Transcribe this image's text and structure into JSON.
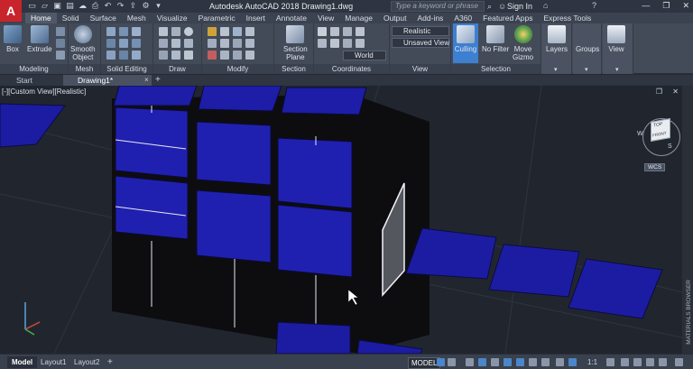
{
  "app": {
    "logo_letter": "A",
    "title": "Autodesk AutoCAD 2018   Drawing1.dwg",
    "search_placeholder": "Type a keyword or phrase",
    "sign_in": "Sign In",
    "window_buttons": [
      "—",
      "❐",
      "✕"
    ]
  },
  "ribbon_tabs": [
    "Home",
    "Solid",
    "Surface",
    "Mesh",
    "Visualize",
    "Parametric",
    "Insert",
    "Annotate",
    "View",
    "Manage",
    "Output",
    "Add-ins",
    "A360",
    "Featured Apps",
    "Express Tools"
  ],
  "active_tab": "Home",
  "ribbon": {
    "tools": {
      "box": "Box",
      "extrude": "Extrude",
      "smooth_object": "Smooth\nObject",
      "section_plane": "Section\nPlane",
      "culling": "Culling",
      "no_filter": "No Filter",
      "move_gizmo": "Move\nGizmo",
      "layers": "Layers",
      "groups": "Groups",
      "view": "View"
    },
    "combos": {
      "visual_style": "Realistic",
      "saved_view": "Unsaved View",
      "ucs": "World"
    },
    "panels": [
      "Modeling",
      "Mesh",
      "Solid Editing",
      "Draw",
      "Modify",
      "Section",
      "Coordinates",
      "View",
      "Selection"
    ],
    "colors": {
      "culling_active": "#3d7fd1",
      "brand_red": "#c8242b"
    }
  },
  "file_tabs": [
    "Start",
    "Drawing1*"
  ],
  "viewport": {
    "label": "[-][Custom View][Realistic]",
    "viewcube": {
      "top": "TOP",
      "front": "FRONT",
      "compass_w": "W",
      "compass_s": "S",
      "wcs": "WCS"
    },
    "cube_color": "#1e1ea8"
  },
  "side_panel": "MATERIALS BROWSER",
  "status": {
    "layout_tabs": [
      "Model",
      "Layout1",
      "Layout2"
    ],
    "add_tab": "+",
    "model_label": "MODEL",
    "scale": "1:1"
  }
}
